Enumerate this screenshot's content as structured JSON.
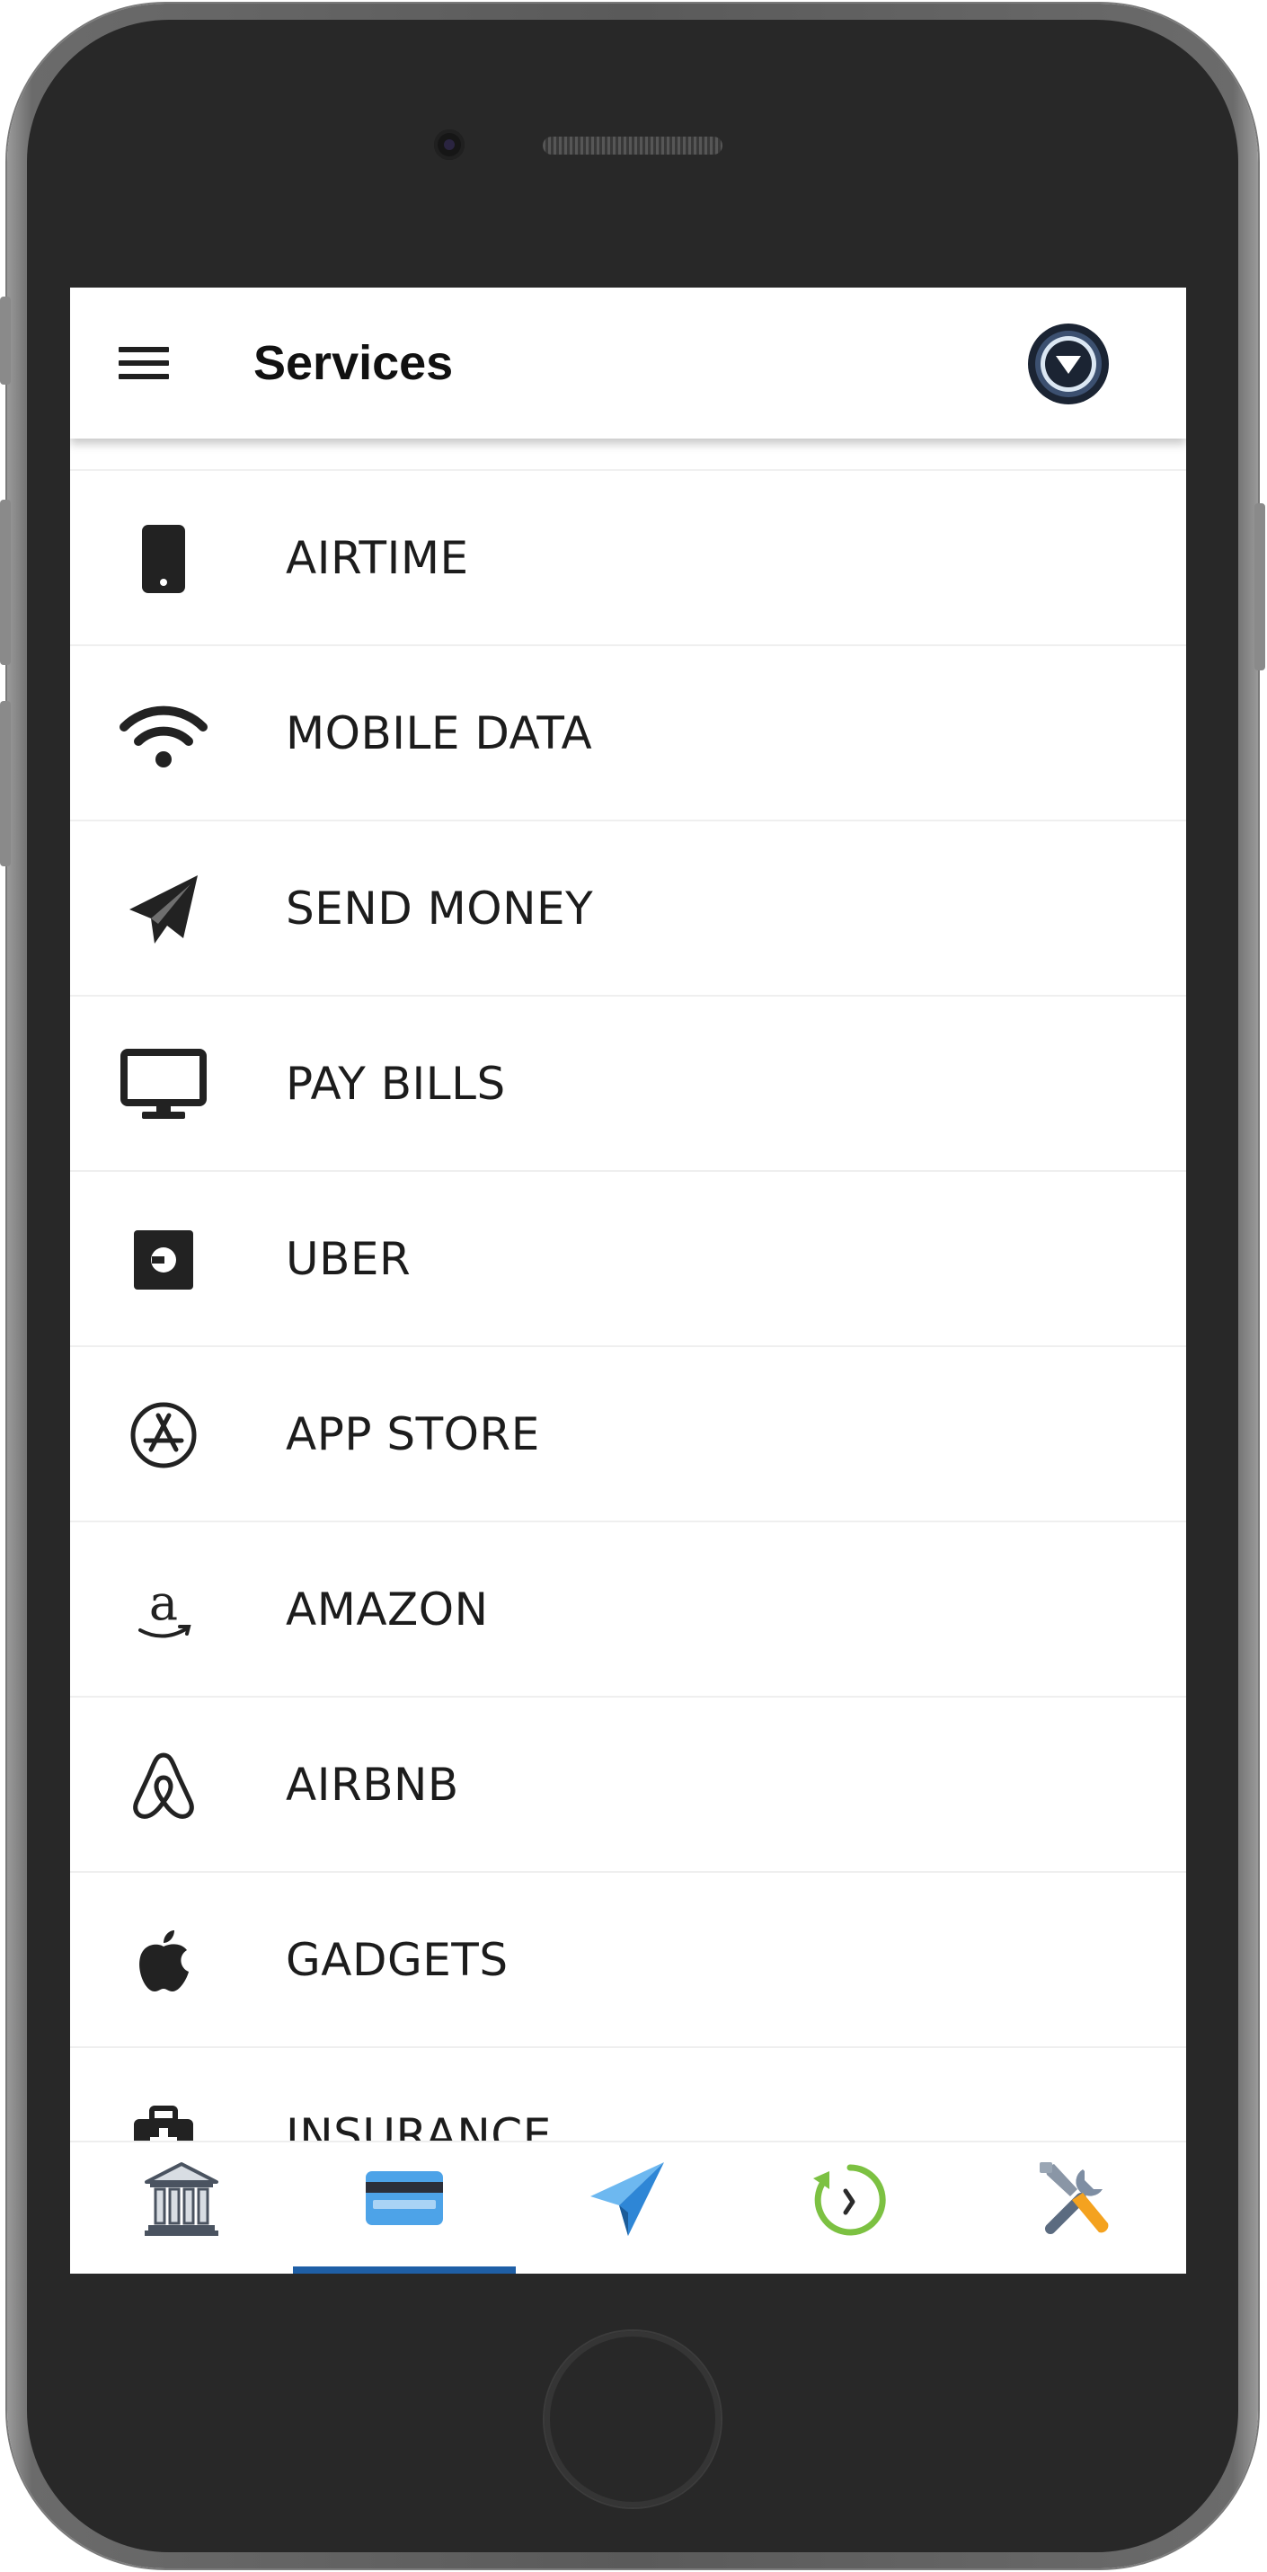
{
  "app_bar": {
    "title": "Services"
  },
  "services": [
    {
      "label": "AIRTIME",
      "icon": "smartphone-icon"
    },
    {
      "label": "MOBILE DATA",
      "icon": "wifi-icon"
    },
    {
      "label": "SEND MONEY",
      "icon": "paper-plane-icon"
    },
    {
      "label": "PAY BILLS",
      "icon": "monitor-icon"
    },
    {
      "label": "UBER",
      "icon": "uber-icon"
    },
    {
      "label": "APP STORE",
      "icon": "app-store-icon"
    },
    {
      "label": "AMAZON",
      "icon": "amazon-icon"
    },
    {
      "label": "AIRBNB",
      "icon": "airbnb-icon"
    },
    {
      "label": "GADGETS",
      "icon": "apple-icon"
    },
    {
      "label": "INSURANCE",
      "icon": "medical-kit-icon"
    }
  ],
  "bottom_nav": {
    "items": [
      {
        "icon": "bank-icon"
      },
      {
        "icon": "credit-card-icon"
      },
      {
        "icon": "paper-plane-icon"
      },
      {
        "icon": "history-icon"
      },
      {
        "icon": "tools-icon"
      }
    ],
    "active_index": 1,
    "accent_color": "#1f5fa6"
  }
}
